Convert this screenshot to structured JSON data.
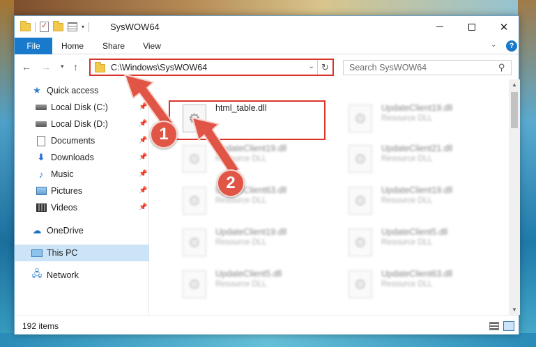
{
  "window": {
    "title": "SysWOW64",
    "controls": {
      "minimize": "minimize",
      "maximize": "maximize",
      "close": "close"
    }
  },
  "ribbon": {
    "tabs": [
      "File",
      "Home",
      "Share",
      "View"
    ],
    "help_label": "?"
  },
  "address_bar": {
    "path": "C:\\Windows\\SysWOW64",
    "refresh_symbol": "↻"
  },
  "search": {
    "placeholder": "Search SysWOW64",
    "icon": "search-icon"
  },
  "nav_pane": {
    "items": [
      {
        "label": "Quick access",
        "icon": "star-icon",
        "pinned": false
      },
      {
        "label": "Local Disk (C:)",
        "icon": "disk-icon",
        "pinned": true
      },
      {
        "label": "Local Disk (D:)",
        "icon": "disk-icon",
        "pinned": true
      },
      {
        "label": "Documents",
        "icon": "document-icon",
        "pinned": true
      },
      {
        "label": "Downloads",
        "icon": "download-icon",
        "pinned": true
      },
      {
        "label": "Music",
        "icon": "music-icon",
        "pinned": true
      },
      {
        "label": "Pictures",
        "icon": "pictures-icon",
        "pinned": true
      },
      {
        "label": "Videos",
        "icon": "videos-icon",
        "pinned": true
      },
      {
        "label": "OneDrive",
        "icon": "onedrive-icon",
        "pinned": false
      },
      {
        "label": "This PC",
        "icon": "pc-icon",
        "pinned": false,
        "selected": true
      },
      {
        "label": "Network",
        "icon": "network-icon",
        "pinned": false
      }
    ]
  },
  "files": [
    {
      "name": "html_table.dll",
      "type": "",
      "highlighted": true
    },
    {
      "name": "UpdateClient19.dll",
      "type": "Resource DLL"
    },
    {
      "name": "UpdateClient19.dll",
      "type": "Resource DLL"
    },
    {
      "name": "UpdateClient21.dll",
      "type": "Resource DLL"
    },
    {
      "name": "UpdateClient63.dll",
      "type": "Resource DLL"
    },
    {
      "name": "UpdateClient19.dll",
      "type": "Resource DLL"
    },
    {
      "name": "UpdateClient19.dll",
      "type": "Resource DLL"
    },
    {
      "name": "UpdateClient5.dll",
      "type": "Resource DLL"
    },
    {
      "name": "UpdateClient5.dll",
      "type": "Resource DLL"
    },
    {
      "name": "UpdateClient63.dll",
      "type": "Resource DLL"
    }
  ],
  "status_bar": {
    "item_count": "192 items"
  },
  "annotations": {
    "badge_1": "1",
    "badge_2": "2",
    "color": "#e05545"
  },
  "colors": {
    "accent": "#1979ca",
    "highlight_border": "#d9342b",
    "selected_bg": "#cce4f7"
  }
}
